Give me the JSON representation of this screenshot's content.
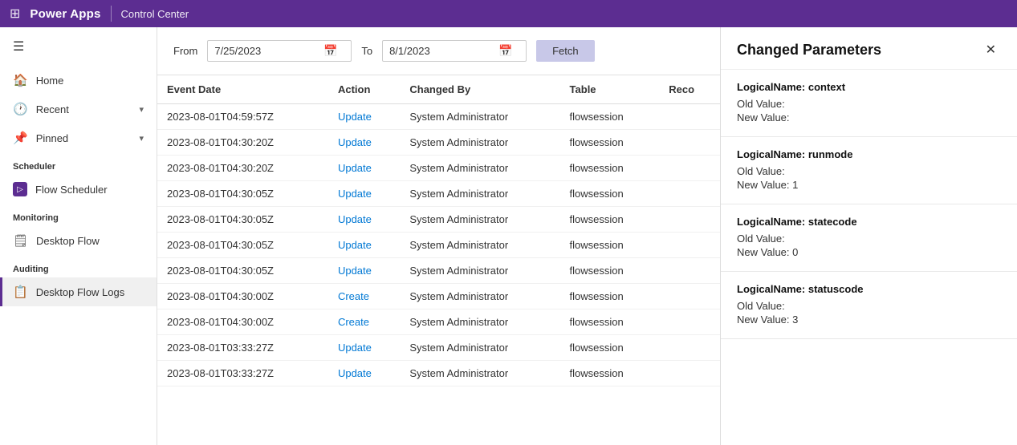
{
  "topbar": {
    "grid_icon": "⊞",
    "app_name": "Power Apps",
    "divider": true,
    "section": "Control Center"
  },
  "sidebar": {
    "hamburger_icon": "☰",
    "nav_items": [
      {
        "id": "home",
        "label": "Home",
        "icon": "🏠",
        "has_chevron": false
      },
      {
        "id": "recent",
        "label": "Recent",
        "icon": "🕐",
        "has_chevron": true
      },
      {
        "id": "pinned",
        "label": "Pinned",
        "icon": "📌",
        "has_chevron": true
      }
    ],
    "scheduler_label": "Scheduler",
    "scheduler_items": [
      {
        "id": "flow-scheduler",
        "label": "Flow Scheduler",
        "icon": "scheduler"
      }
    ],
    "monitoring_label": "Monitoring",
    "monitoring_items": [
      {
        "id": "desktop-flow",
        "label": "Desktop Flow",
        "icon": "🗒"
      }
    ],
    "auditing_label": "Auditing",
    "auditing_items": [
      {
        "id": "desktop-flow-logs",
        "label": "Desktop Flow Logs",
        "icon": "📋",
        "active": true
      }
    ]
  },
  "filter": {
    "from_label": "From",
    "from_value": "7/25/2023",
    "to_label": "To",
    "to_value": "8/1/2023",
    "fetch_label": "Fetch"
  },
  "table": {
    "columns": [
      "Event Date",
      "Action",
      "Changed By",
      "Table",
      "Reco"
    ],
    "rows": [
      {
        "event_date": "2023-08-01T04:59:57Z",
        "action": "Update",
        "changed_by": "System Administrator",
        "table": "flowsession"
      },
      {
        "event_date": "2023-08-01T04:30:20Z",
        "action": "Update",
        "changed_by": "System Administrator",
        "table": "flowsession"
      },
      {
        "event_date": "2023-08-01T04:30:20Z",
        "action": "Update",
        "changed_by": "System Administrator",
        "table": "flowsession"
      },
      {
        "event_date": "2023-08-01T04:30:05Z",
        "action": "Update",
        "changed_by": "System Administrator",
        "table": "flowsession"
      },
      {
        "event_date": "2023-08-01T04:30:05Z",
        "action": "Update",
        "changed_by": "System Administrator",
        "table": "flowsession"
      },
      {
        "event_date": "2023-08-01T04:30:05Z",
        "action": "Update",
        "changed_by": "System Administrator",
        "table": "flowsession"
      },
      {
        "event_date": "2023-08-01T04:30:05Z",
        "action": "Update",
        "changed_by": "System Administrator",
        "table": "flowsession"
      },
      {
        "event_date": "2023-08-01T04:30:00Z",
        "action": "Create",
        "changed_by": "System Administrator",
        "table": "flowsession"
      },
      {
        "event_date": "2023-08-01T04:30:00Z",
        "action": "Create",
        "changed_by": "System Administrator",
        "table": "flowsession"
      },
      {
        "event_date": "2023-08-01T03:33:27Z",
        "action": "Update",
        "changed_by": "System Administrator",
        "table": "flowsession"
      },
      {
        "event_date": "2023-08-01T03:33:27Z",
        "action": "Update",
        "changed_by": "System Administrator",
        "table": "flowsession"
      }
    ]
  },
  "side_panel": {
    "title": "Changed Parameters",
    "close_icon": "✕",
    "params": [
      {
        "name": "LogicalName: context",
        "old_label": "Old Value:",
        "old_value": "",
        "new_label": "New Value:",
        "new_value": ""
      },
      {
        "name": "LogicalName: runmode",
        "old_label": "Old Value:",
        "old_value": "",
        "new_label": "New Value:",
        "new_value": "1"
      },
      {
        "name": "LogicalName: statecode",
        "old_label": "Old Value:",
        "old_value": "",
        "new_label": "New Value:",
        "new_value": "0"
      },
      {
        "name": "LogicalName: statuscode",
        "old_label": "Old Value:",
        "old_value": "",
        "new_label": "New Value:",
        "new_value": "3"
      }
    ]
  }
}
